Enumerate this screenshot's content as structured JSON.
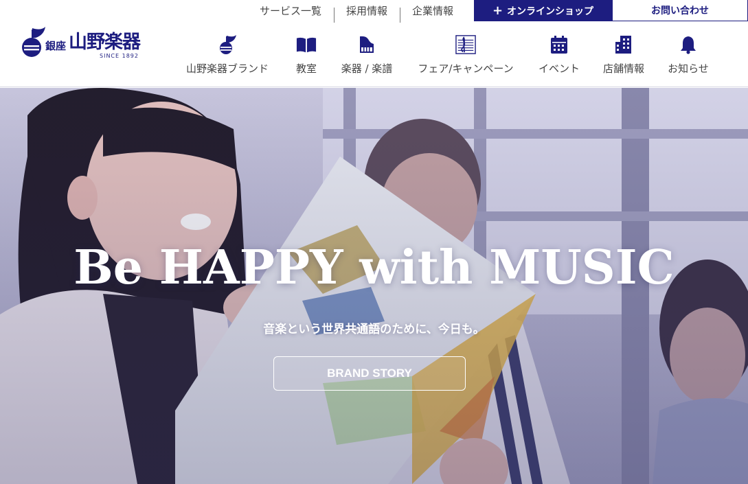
{
  "utility_nav": {
    "links": [
      "サービス一覧",
      "採用情報",
      "企業情報"
    ],
    "shop_label": "オンラインショップ",
    "contact_label": "お問い合わせ"
  },
  "logo": {
    "ginza": "銀座",
    "name": "山野楽器",
    "since": "SINCE 1892"
  },
  "main_nav": {
    "items": [
      {
        "label": "山野楽器ブランド",
        "icon": "brand-note-icon"
      },
      {
        "label": "教室",
        "icon": "book-icon"
      },
      {
        "label": "楽器 / 楽譜",
        "icon": "piano-icon"
      },
      {
        "label": "フェア/キャンペーン",
        "icon": "score-icon"
      },
      {
        "label": "イベント",
        "icon": "calendar-icon"
      },
      {
        "label": "店舗情報",
        "icon": "building-icon"
      },
      {
        "label": "お知らせ",
        "icon": "bell-icon"
      }
    ]
  },
  "hero": {
    "title": "Be HAPPY with MUSIC",
    "subtitle": "音楽という世界共通語のために、今日も。",
    "button_label": "BRAND STORY"
  },
  "colors": {
    "brand_navy": "#1d1d80",
    "header_bg": "#ffffff",
    "hero_tint": "#b9b8d4"
  }
}
